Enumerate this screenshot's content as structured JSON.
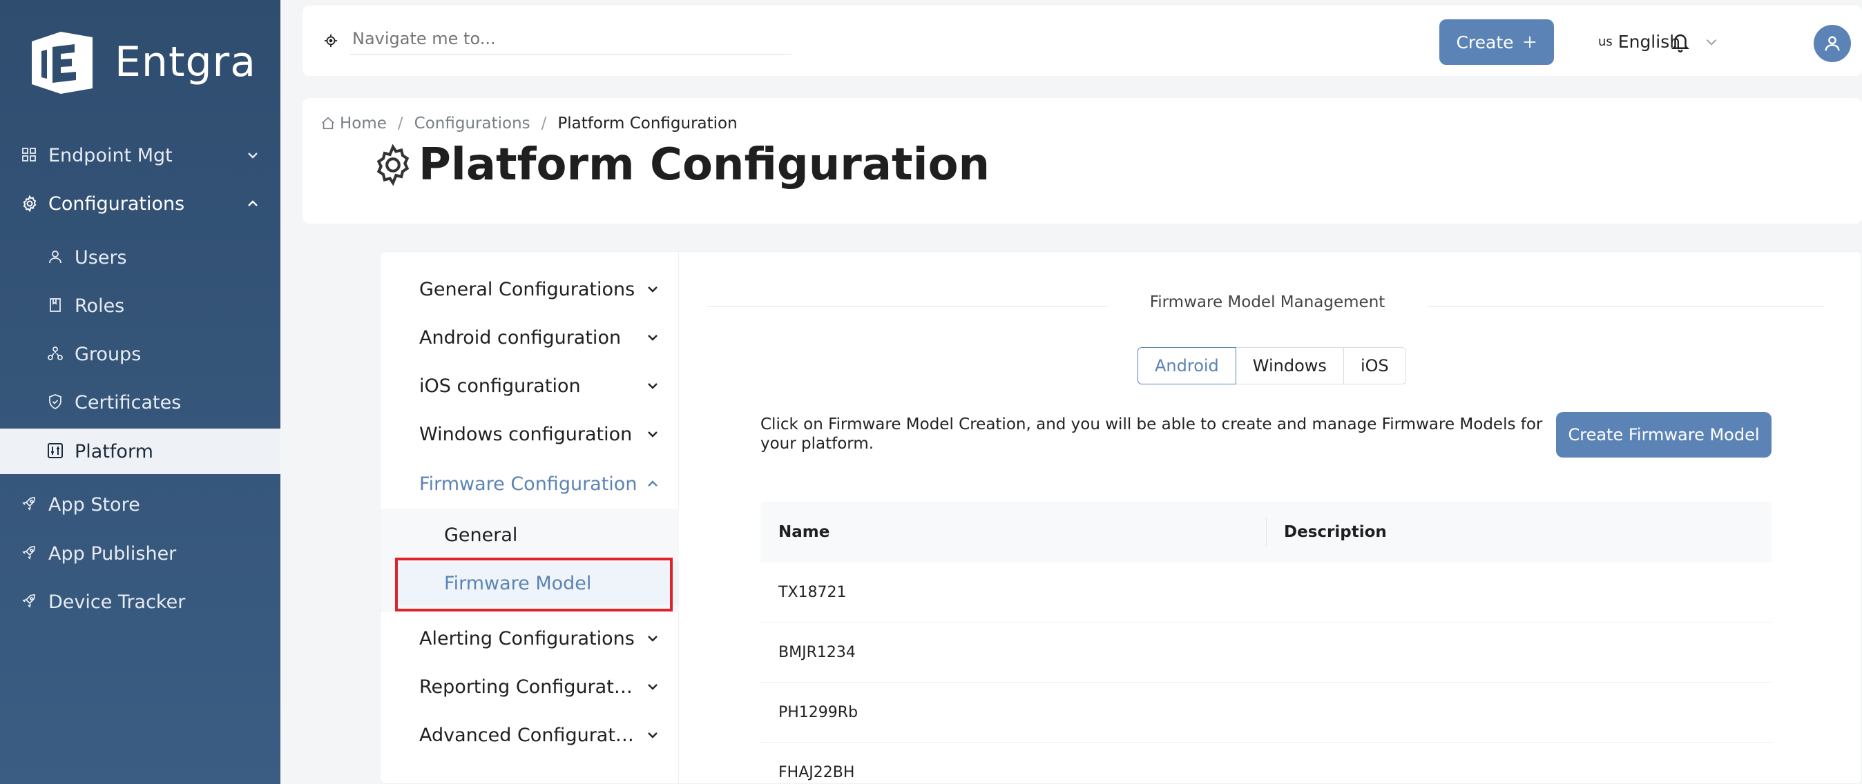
{
  "brand": {
    "name": "Entgra"
  },
  "colors": {
    "sidebar": "#2f4d6f",
    "accent": "#5b83b5",
    "highlight": "#e0232b"
  },
  "sidebar": {
    "items": [
      {
        "label": "Endpoint Mgt",
        "icon": "grid-icon"
      },
      {
        "label": "Configurations",
        "icon": "gear-icon"
      },
      {
        "label": "Users",
        "icon": "user-icon"
      },
      {
        "label": "Roles",
        "icon": "book-icon"
      },
      {
        "label": "Groups",
        "icon": "groups-icon"
      },
      {
        "label": "Certificates",
        "icon": "shield-icon"
      },
      {
        "label": "Platform",
        "icon": "sliders-icon"
      },
      {
        "label": "App Store",
        "icon": "rocket-icon"
      },
      {
        "label": "App Publisher",
        "icon": "rocket-icon"
      },
      {
        "label": "Device Tracker",
        "icon": "rocket-icon"
      }
    ]
  },
  "topbar": {
    "search_placeholder": "Navigate me to...",
    "create_label": "Create",
    "lang_code": "us",
    "lang_label": "English"
  },
  "header": {
    "breadcrumb": [
      "Home",
      "Configurations",
      "Platform Configuration"
    ],
    "title": "Platform Configuration"
  },
  "config_menu": {
    "items": [
      "General Configurations",
      "Android configuration",
      "iOS configuration",
      "Windows configuration",
      "Firmware Configuration",
      "Alerting Configurations",
      "Reporting Configurations",
      "Advanced Configurations"
    ],
    "sub_items": [
      "General",
      "Firmware Model"
    ]
  },
  "panel": {
    "section_title": "Firmware Model Management",
    "tabs": [
      "Android",
      "Windows",
      "iOS"
    ],
    "active_tab": "Android",
    "description": "Click on Firmware Model Creation, and you will be able to create and manage Firmware Models for your platform.",
    "create_button": "Create Firmware Model",
    "table": {
      "columns": [
        "Name",
        "Description"
      ],
      "rows": [
        {
          "name": "TX18721",
          "description": ""
        },
        {
          "name": "BMJR1234",
          "description": ""
        },
        {
          "name": "PH1299Rb",
          "description": ""
        },
        {
          "name": "FHAJ22BH",
          "description": ""
        }
      ]
    }
  }
}
